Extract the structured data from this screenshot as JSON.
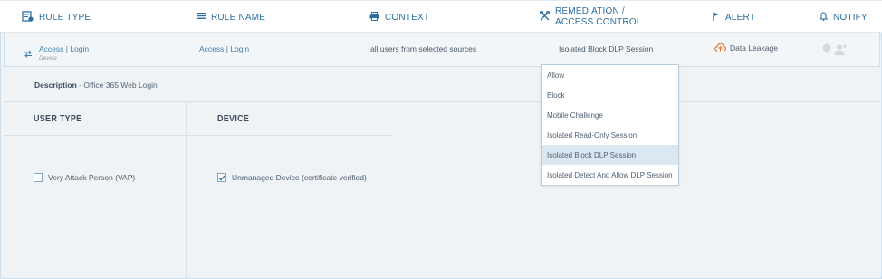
{
  "header": {
    "rule_type": "RULE TYPE",
    "rule_name": "RULE NAME",
    "context": "CONTEXT",
    "remediation_line1": "REMEDIATION /",
    "remediation_line2": "ACCESS CONTROL",
    "alert": "ALERT",
    "notify": "NOTIFY"
  },
  "rule": {
    "type": "Access | Login",
    "type_sub": "Device",
    "name": "Access | Login",
    "context": "all users from selected sources",
    "remediation": "Isolated Block DLP Session",
    "alert": "Data Leakage"
  },
  "description": {
    "label": "Description",
    "value": "- Office 365 Web Login"
  },
  "sections": {
    "user_type": "USER TYPE",
    "device": "DEVICE"
  },
  "user_type_options": [
    {
      "label": "Very Attack Person (VAP)",
      "checked": false
    }
  ],
  "device_options": [
    {
      "label": "Unmanaged Device (certificate verified)",
      "checked": true
    }
  ],
  "remediation_options": [
    "Allow",
    "Block",
    "Mobile Challenge",
    "Isolated Read-Only Session",
    "Isolated Block DLP Session",
    "Isolated Detect And Allow DLP Session"
  ],
  "selected_remediation": "Isolated Block DLP Session",
  "colors": {
    "accent": "#2e6f9e",
    "alert_orange": "#e8762b",
    "row_bg": "#eff3f6",
    "selected_option_bg": "#dbe7f1"
  },
  "icons": {
    "rule_type": "rule-type-icon",
    "rule_name": "list-icon",
    "context": "printer-icon",
    "remediation": "tools-icon",
    "alert": "flag-icon",
    "notify": "bell-icon",
    "row_type": "swap-arrows-icon",
    "alert_cloud": "cloud-upload-icon",
    "notify_users": "users-icon"
  }
}
